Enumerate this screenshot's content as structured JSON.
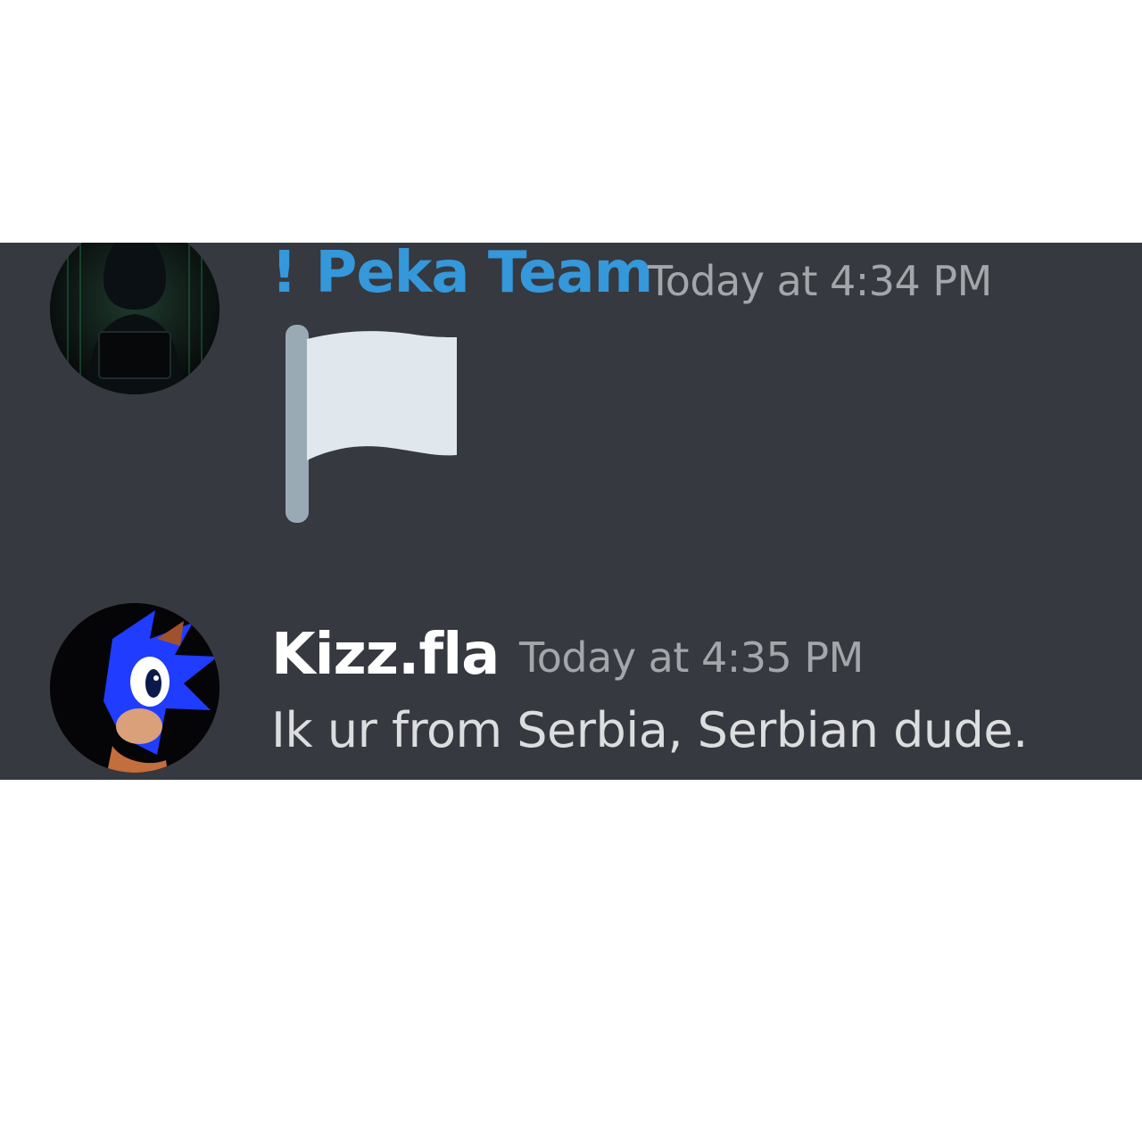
{
  "messages": [
    {
      "author": "! Peka Team",
      "author_color": "#3498db",
      "timestamp": "Today at 4:34 PM",
      "content_icon": "white-flag-emoji",
      "avatar_icon": "hooded-hacker-avatar"
    },
    {
      "author": "Kizz.fla",
      "author_color": "#ffffff",
      "timestamp": "Today at 4:35 PM",
      "content": "Ik ur from Serbia, Serbian dude.",
      "avatar_icon": "blue-hedgehog-avatar"
    }
  ],
  "colors": {
    "background": "#36393f",
    "timestamp": "#a3a6aa",
    "text": "#dcddde"
  }
}
